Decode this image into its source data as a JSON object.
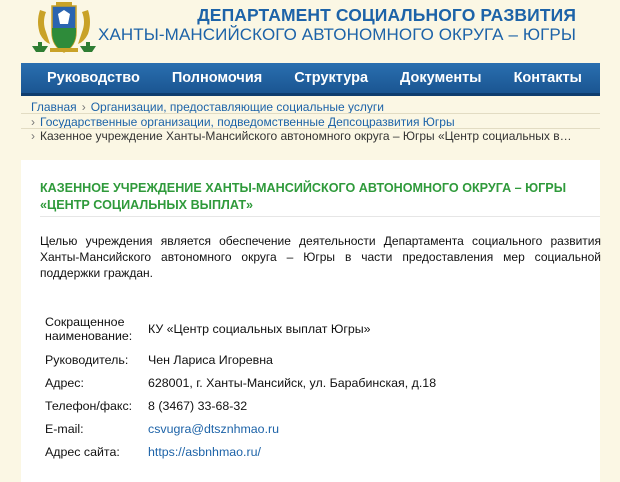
{
  "header": {
    "title_line1": "ДЕПАРТАМЕНТ СОЦИАЛЬНОГО РАЗВИТИЯ",
    "title_line2": "ХАНТЫ-МАНСИЙСКОГО АВТОНОМНОГО ОКРУГА – ЮГРЫ",
    "emblem": "coat-of-arms-icon"
  },
  "nav": {
    "items": [
      "Руководство",
      "Полномочия",
      "Структура",
      "Документы",
      "Контакты"
    ]
  },
  "breadcrumbs": {
    "home": "Главная",
    "level1": "Организации, предоставляющие социальные услуги",
    "level2": "Государственные организации, подведомственные Депсоцразвития Югры",
    "current": "Казенное учреждение Ханты-Мансийского автономного округа – Югры «Центр социальных в…"
  },
  "page": {
    "title_line1": "КАЗЕННОЕ УЧРЕЖДЕНИЕ ХАНТЫ-МАНСИЙСКОГО АВТОНОМНОГО ОКРУГА – ЮГРЫ",
    "title_line2": "«ЦЕНТР СОЦИАЛЬНЫХ ВЫПЛАТ»",
    "intro": "Целью учреждения является обеспечение деятельности Департамента социального развития Ханты-Мансийского автономного округа – Югры  в части предоставления мер социальной поддержки граждан."
  },
  "info": {
    "short_name_label1": "Сокращенное",
    "short_name_label2": "наименование:",
    "short_name": "КУ «Центр социальных выплат Югры»",
    "head_label": "Руководитель:",
    "head": "Чен Лариса Игоревна",
    "address_label": "Адрес:",
    "address": "628001, г. Ханты-Мансийск, ул. Барабинская, д.18",
    "phone_label": "Телефон/факс:",
    "phone": "8 (3467) 33-68-32",
    "email_label": "E-mail:",
    "email": "csvugra@dtsznhmao.ru",
    "site_label": "Адрес сайта:",
    "site": "https://asbnhmao.ru/"
  },
  "colors": {
    "brand_blue": "#1d63a8",
    "title_green": "#2f9a3b",
    "nav_bg": "#1f5f9f",
    "page_bg": "#fbf7e4"
  }
}
